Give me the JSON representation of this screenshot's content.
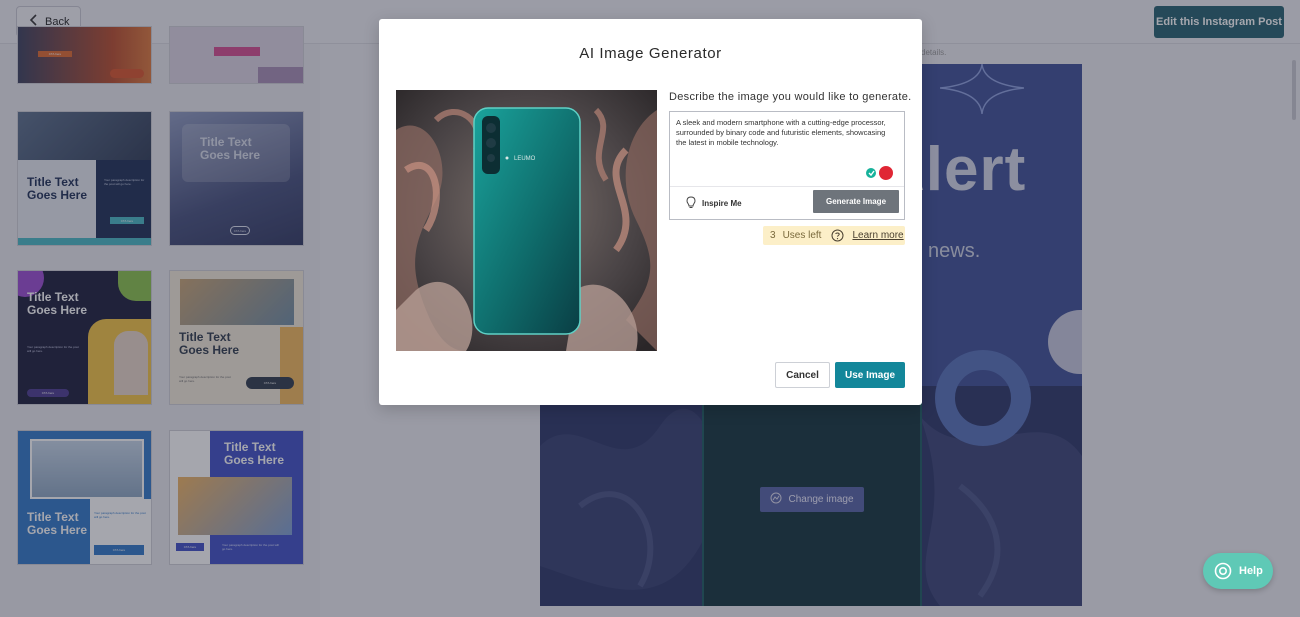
{
  "header": {
    "back_label": "Back",
    "edit_label": "Edit this Instagram Post"
  },
  "templates": [
    {
      "title": "",
      "desc": "",
      "cta": "CTA here"
    },
    {
      "title": "",
      "desc": "",
      "cta": ""
    },
    {
      "title": "Title Text\nGoes Here",
      "desc": "Your paragraph description for the post will go here.",
      "cta": "CTA here"
    },
    {
      "title": "Title Text\nGoes Here",
      "desc": "",
      "cta": "CTA here"
    },
    {
      "title": "Title Text\nGoes Here",
      "desc": "Your paragraph description for the post will go here.",
      "cta": "CTA here"
    },
    {
      "title": "Title Text\nGoes Here",
      "desc": "Your paragraph description for the post will go here.",
      "cta": "CTA here"
    },
    {
      "title": "Title Text\nGoes Here",
      "desc": "Your paragraph description for the post will go here.",
      "cta": "CTA here"
    },
    {
      "title": "Title Text\nGoes Here",
      "desc": "Your paragraph description for the post will go here.",
      "cta": "CTA here"
    }
  ],
  "canvas": {
    "headline_fragment": "Alert",
    "subline_fragment": "news.",
    "change_image_label": "Change image",
    "details_fragment": "details."
  },
  "modal": {
    "title": "AI Image Generator",
    "prompt_label": "Describe the image you would like to generate.",
    "prompt_value": "A sleek and modern smartphone with a cutting-edge processor, surrounded by binary code and futuristic elements, showcasing the latest in mobile technology.",
    "inspire_label": "Inspire Me",
    "generate_label": "Generate Image",
    "uses_count": "3",
    "uses_label": "Uses left",
    "learn_more_label": "Learn more",
    "cancel_label": "Cancel",
    "use_label": "Use Image",
    "phone_brand_text": "LEUMO"
  },
  "help_label": "Help",
  "colors": {
    "accent_teal": "#13879a",
    "edit_button": "#24606e",
    "help_bubble": "#5fc9b6",
    "uses_badge_bg": "#fcefc8",
    "canvas_blue": "#3d4f96"
  },
  "icons": {
    "back": "chevron-left-icon",
    "inspire": "lightbulb-icon",
    "help_circle": "question-circle-icon",
    "change_image": "image-swap-icon",
    "help": "lifebuoy-icon",
    "grammar": "grammar-check-icon"
  }
}
